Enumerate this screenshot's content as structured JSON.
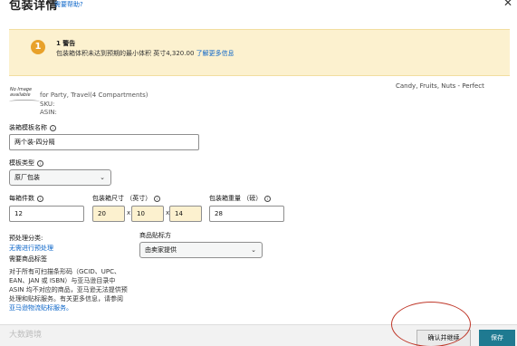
{
  "header": {
    "title": "包装详情",
    "help_link": "需要帮助?",
    "close_icon": "close-icon"
  },
  "warning": {
    "badge": "1",
    "title": "1 警告",
    "text": "包装箱体积未达到预期的最小体积 英寸4,320.00",
    "link": "了解更多信息",
    "color": "#fcf1cf"
  },
  "product": {
    "image_text": "No Image available",
    "title_left": "for Party, Travel(4 Compartments)",
    "title_right": "Candy, Fruits, Nuts - Perfect",
    "sku_label": "SKU:",
    "asin_label": "ASIN:"
  },
  "form": {
    "template_name_label": "装箱模板名称",
    "template_name_value": "两个装-四分隔",
    "template_type_label": "模板类型",
    "template_type_value": "原厂包装",
    "units_per_box_label": "每箱件数",
    "units_per_box_value": "12",
    "box_dims_label": "包装箱尺寸 （英寸）",
    "box_dims": [
      "20",
      "10",
      "14"
    ],
    "times_symbol": "x",
    "box_weight_label": "包装箱重量 （磅）",
    "box_weight_value": "28",
    "prep_label": "预处理分类:",
    "prep_value": "无需进行预处理",
    "label_required": "需要商品标签",
    "labeling_owner_label": "商品贴标方",
    "labeling_owner_value": "由卖家提供",
    "info_paragraph": "对于所有可扫描条形码（GCID、UPC、EAN、JAN 或 ISBN）与亚马逊目录中 ASIN 均不对应的商品，亚马逊无法提供预处理和贴标服务。有关更多信息，请参阅",
    "info_link": "亚马逊物流贴标服务。"
  },
  "footer": {
    "continue_label": "确认并继续",
    "save_label": "保存",
    "watermark": "大数跨境",
    "save_color": "#1f7a91"
  }
}
